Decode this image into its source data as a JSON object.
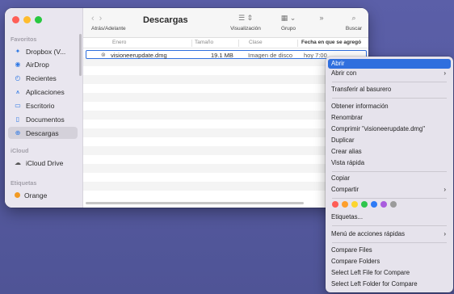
{
  "window": {
    "sidebar": {
      "favorites_heading": "Favoritos",
      "favorites": [
        {
          "label": "Dropbox (V...",
          "icon": "dropbox-icon"
        },
        {
          "label": "AirDrop",
          "icon": "airdrop-icon"
        },
        {
          "label": "Recientes",
          "icon": "clock-icon"
        },
        {
          "label": "Aplicaciones",
          "icon": "apps-icon"
        },
        {
          "label": "Escritorio",
          "icon": "desktop-icon"
        },
        {
          "label": "Documentos",
          "icon": "document-icon"
        },
        {
          "label": "Descargas",
          "icon": "download-icon",
          "selected": true
        }
      ],
      "icloud_heading": "iCloud",
      "icloud": [
        {
          "label": "iCloud Drive",
          "icon": "cloud-icon"
        }
      ],
      "tags_heading": "Etiquetas",
      "tags": [
        {
          "label": "Orange",
          "color": "#f29a24"
        }
      ]
    },
    "toolbar": {
      "nav_label": "Atrás/Adelante",
      "title": "Descargas",
      "view_label": "Visualización",
      "group_label": "Grupo",
      "search_label": "Buscar"
    },
    "columns": {
      "name": "Enero",
      "size": "Tamaño",
      "kind": "Clase",
      "date": "Fecha en que se agregó"
    },
    "file": {
      "name": "visioneerupdate.dmg",
      "size": "19.1 MB",
      "kind": "Imagen de disco",
      "date": "hoy 7:00"
    }
  },
  "context_menu": {
    "open": "Abrir",
    "open_with": "Abrir con",
    "trash": "Transferir al basurero",
    "get_info": "Obtener información",
    "rename": "Renombrar",
    "compress": "Comprimir \"visioneerupdate.dmg\"",
    "duplicate": "Duplicar",
    "alias": "Crear alias",
    "quicklook": "Vista rápida",
    "copy": "Copiar",
    "share": "Compartir",
    "tag_colors": [
      "#fe5d56",
      "#fd9f2b",
      "#fcd52f",
      "#2ec54c",
      "#2e7bf6",
      "#a95cde",
      "#9b9b9b"
    ],
    "tags": "Etiquetas...",
    "quick_actions": "Menú de acciones rápidas",
    "compare_files": "Compare Files",
    "compare_folders": "Compare Folders",
    "select_left_file": "Select Left File for Compare",
    "select_left_folder": "Select Left Folder for Compare"
  }
}
